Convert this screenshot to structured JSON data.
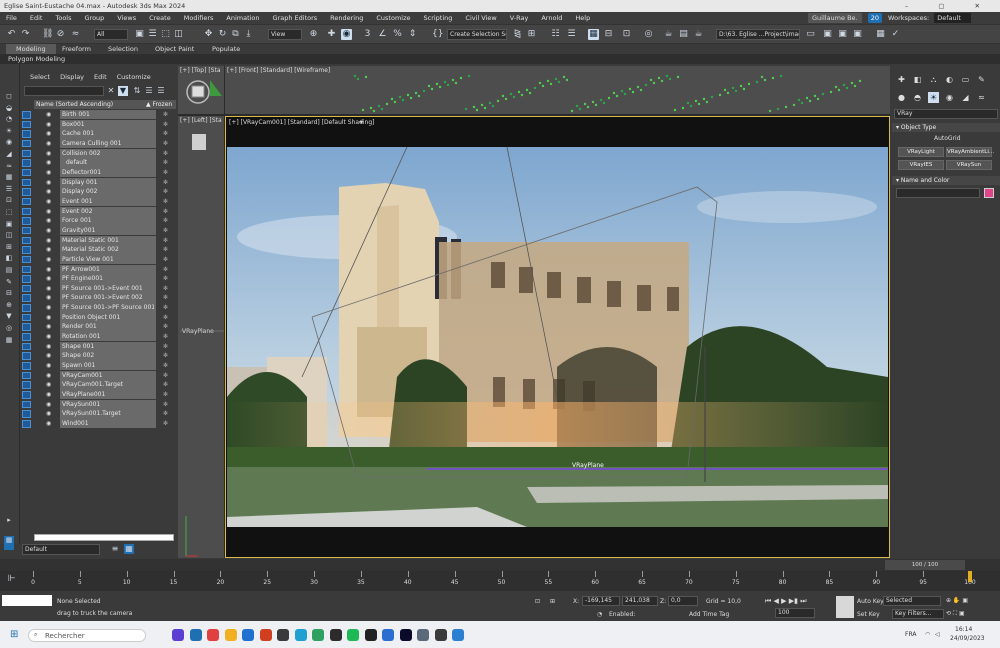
{
  "window": {
    "title": "Eglise Saint-Eustache 04.max - Autodesk 3ds Max 2024",
    "controls": "–  ▢  ✕"
  },
  "menu": {
    "items": [
      "File",
      "Edit",
      "Tools",
      "Group",
      "Views",
      "Create",
      "Modifiers",
      "Animation",
      "Graph Editors",
      "Rendering",
      "Customize",
      "Scripting",
      "Civil View",
      "V-Ray",
      "Arnold",
      "Help"
    ],
    "user": "Guillaume Be.",
    "notif_count": "20",
    "workspaces_label": "Workspaces:",
    "workspace_value": "Default"
  },
  "toolbar": {
    "filter_value": "All",
    "ref_coord_value": "View",
    "selection_set_placeholder": "Create Selection Se",
    "path_value": "D:\\63. Eglise ...Project\\image"
  },
  "ribbon": {
    "tabs": [
      "Modeling",
      "Freeform",
      "Selection",
      "Object Paint",
      "Populate"
    ],
    "sub_label": "Polygon Modeling"
  },
  "explorer": {
    "menu": [
      "Select",
      "Display",
      "Edit",
      "Customize"
    ],
    "header_name": "Name (Sorted Ascending)",
    "header_frozen": "▲ Frozen",
    "frozen_glyph": "✻",
    "rows": [
      {
        "label": "Birth 001"
      },
      {
        "label": "Box001"
      },
      {
        "label": "Cache 001"
      },
      {
        "label": "Camera Culling 001"
      },
      {
        "label": "Collision 002"
      },
      {
        "label": "default",
        "child": true
      },
      {
        "label": "Deflector001"
      },
      {
        "label": "Display 001"
      },
      {
        "label": "Display 002"
      },
      {
        "label": "Event 001"
      },
      {
        "label": "Event 002"
      },
      {
        "label": "Force 001"
      },
      {
        "label": "Gravity001"
      },
      {
        "label": "Material Static 001"
      },
      {
        "label": "Material Static 002"
      },
      {
        "label": "Particle View 001"
      },
      {
        "label": "PF Arrow001"
      },
      {
        "label": "PF Engine001"
      },
      {
        "label": "PF Source 001->Event 001"
      },
      {
        "label": "PF Source 001->Event 002"
      },
      {
        "label": "PF Source 001->PF Source 001"
      },
      {
        "label": "Position Object 001"
      },
      {
        "label": "Render 001"
      },
      {
        "label": "Rotation 001"
      },
      {
        "label": "Shape 001"
      },
      {
        "label": "Shape 002"
      },
      {
        "label": "Spawn 001"
      },
      {
        "label": "VRayCam001"
      },
      {
        "label": "VRayCam001.Target"
      },
      {
        "label": "VRayPlane001"
      },
      {
        "label": "VRaySun001"
      },
      {
        "label": "VRaySun001.Target"
      },
      {
        "label": "Wind001"
      }
    ],
    "layer_value": "Default"
  },
  "viewports": {
    "top_label": "[+] [Top] [Sta",
    "front_label": "[+] [Front] [Standard] [Wireframe]",
    "left_label": "[+] [Left] [Sta",
    "cam_label": "[+] [VRayCam001] [Standard] [Default Shading]",
    "vrayplane_left": "VRayPlane",
    "vrayplane_cam": "VRayPlane"
  },
  "cmdpanel": {
    "category": "VRay",
    "object_type_title": "Object Type",
    "autogrid": "AutoGrid",
    "buttons": [
      "VRayLight",
      "VRayAmbientLi...",
      "VRayIES",
      "VRaySun"
    ],
    "name_color_title": "Name and Color",
    "swatch_color": "#e0458a"
  },
  "timeline": {
    "slider_text": "100 / 100",
    "ticks": [
      0,
      5,
      10,
      15,
      20,
      25,
      30,
      35,
      40,
      45,
      50,
      55,
      60,
      65,
      70,
      75,
      80,
      85,
      90,
      95,
      100
    ],
    "current_frame": 100
  },
  "status": {
    "selection": "None Selected",
    "prompt": "drag to truck the camera",
    "x_label": "X:",
    "x_value": "-169,145",
    "y_label": "Y:",
    "y_value": "241,038",
    "z_label": "Z:",
    "z_value": "0,0",
    "grid": "Grid = 10,0",
    "enabled_label": "Enabled:",
    "add_time_tag": "Add Time Tag",
    "frame_value": "100",
    "auto_key": "Auto Key",
    "selected_value": "Selected",
    "set_key": "Set Key",
    "key_filters": "Key Filters..."
  },
  "taskbar": {
    "search_placeholder": "Rechercher",
    "lang": "FRA",
    "time": "16:14",
    "date": "24/09/2023"
  }
}
